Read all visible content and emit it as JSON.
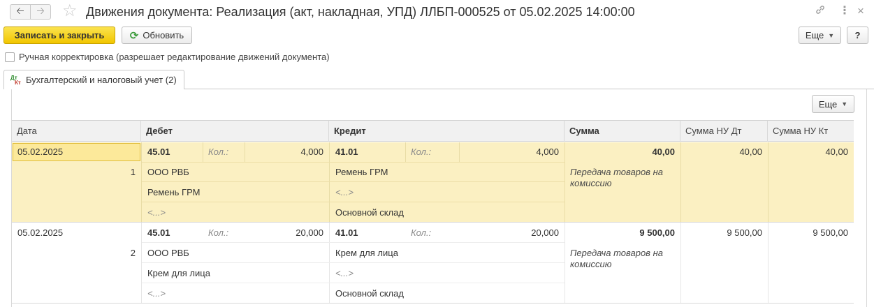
{
  "window": {
    "title": "Движения документа: Реализация (акт, накладная, УПД) ЛЛБП-000525 от 05.02.2025 14:00:00",
    "back_icon": "arrow-left-icon",
    "forward_icon": "arrow-right-icon",
    "favorite_icon": "star-icon",
    "link_icon": "link-icon",
    "menu_icon": "kebab-menu-icon",
    "close_icon": "close-icon"
  },
  "toolbar": {
    "save_close_label": "Записать и закрыть",
    "refresh_label": "Обновить",
    "more_label": "Еще",
    "help_label": "?"
  },
  "manual_edit": {
    "label": "Ручная корректировка (разрешает редактирование движений документа)",
    "checked": false
  },
  "tabs": [
    {
      "icon_dt": "Дт",
      "icon_kt": "Кт",
      "label": "Бухгалтерский и налоговый учет (2)"
    }
  ],
  "table": {
    "more_label": "Еще",
    "columns": [
      "Дата",
      "Дебет",
      "Кредит",
      "Сумма",
      "Сумма НУ Дт",
      "Сумма НУ Кт"
    ],
    "rows": [
      {
        "date": "05.02.2025",
        "num": "1",
        "debit_account": "45.01",
        "debit_qty_label": "Кол.:",
        "debit_qty": "4,000",
        "debit_sub1": "ООО РВБ",
        "debit_sub2": "Ремень ГРМ",
        "debit_sub3": "<...>",
        "credit_account": "41.01",
        "credit_qty_label": "Кол.:",
        "credit_qty": "4,000",
        "credit_sub1": "Ремень ГРМ",
        "credit_sub2": "<...>",
        "credit_sub3": "Основной склад",
        "sum": "40,00",
        "content": "Передача товаров на комиссию",
        "sum_nu_dt": "40,00",
        "sum_nu_kt": "40,00"
      },
      {
        "date": "05.02.2025",
        "num": "2",
        "debit_account": "45.01",
        "debit_qty_label": "Кол.:",
        "debit_qty": "20,000",
        "debit_sub1": "ООО РВБ",
        "debit_sub2": "Крем для лица",
        "debit_sub3": "<...>",
        "credit_account": "41.01",
        "credit_qty_label": "Кол.:",
        "credit_qty": "20,000",
        "credit_sub1": "Крем для лица",
        "credit_sub2": "<...>",
        "credit_sub3": "Основной склад",
        "sum": "9 500,00",
        "content": "Передача товаров на комиссию",
        "sum_nu_dt": "9 500,00",
        "sum_nu_kt": "9 500,00"
      }
    ]
  }
}
